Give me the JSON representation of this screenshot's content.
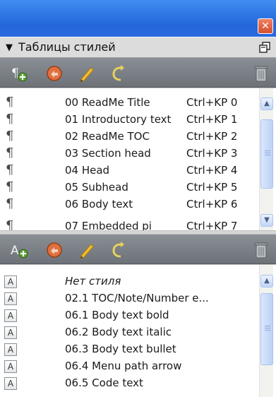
{
  "window": {
    "close_symbol": "✕"
  },
  "panel": {
    "title": "Таблицы стилей",
    "collapse_symbol": "▼"
  },
  "top_toolbar": {
    "icons": [
      "new-paragraph-style-icon",
      "apply-style-icon",
      "edit-style-icon",
      "duplicate-style-icon",
      "delete-style-icon"
    ]
  },
  "bottom_toolbar": {
    "icons": [
      "new-character-style-icon",
      "apply-style-icon",
      "edit-style-icon",
      "duplicate-style-icon",
      "delete-style-icon"
    ]
  },
  "paragraph_styles": [
    {
      "mark": "¶",
      "name": "00 ReadMe Title",
      "shortcut": "Ctrl+KP 0"
    },
    {
      "mark": "¶",
      "name": "01 Introductory text",
      "shortcut": "Ctrl+KP 1"
    },
    {
      "mark": "¶",
      "name": "02 ReadMe TOC",
      "shortcut": "Ctrl+KP 2"
    },
    {
      "mark": "¶",
      "name": "03 Section head",
      "shortcut": "Ctrl+KP 3"
    },
    {
      "mark": "¶",
      "name": "04 Head",
      "shortcut": "Ctrl+KP 4"
    },
    {
      "mark": "¶",
      "name": "05 Subhead",
      "shortcut": "Ctrl+KP 5"
    },
    {
      "mark": "¶",
      "name": "06 Body text",
      "shortcut": "Ctrl+KP 6"
    },
    {
      "mark": "¶",
      "name": "07 Embedded pi",
      "shortcut": "Ctrl+KP 7"
    }
  ],
  "character_styles": [
    {
      "mark": "A",
      "name": "Нет стиля"
    },
    {
      "mark": "A",
      "name": "02.1 TOC/Note/Number e..."
    },
    {
      "mark": "A",
      "name": "06.1 Body text bold"
    },
    {
      "mark": "A",
      "name": "06.2 Body text italic"
    },
    {
      "mark": "A",
      "name": "06.3 Body text bullet"
    },
    {
      "mark": "A",
      "name": "06.4 Menu path arrow"
    },
    {
      "mark": "A",
      "name": "06.5 Code text"
    }
  ]
}
